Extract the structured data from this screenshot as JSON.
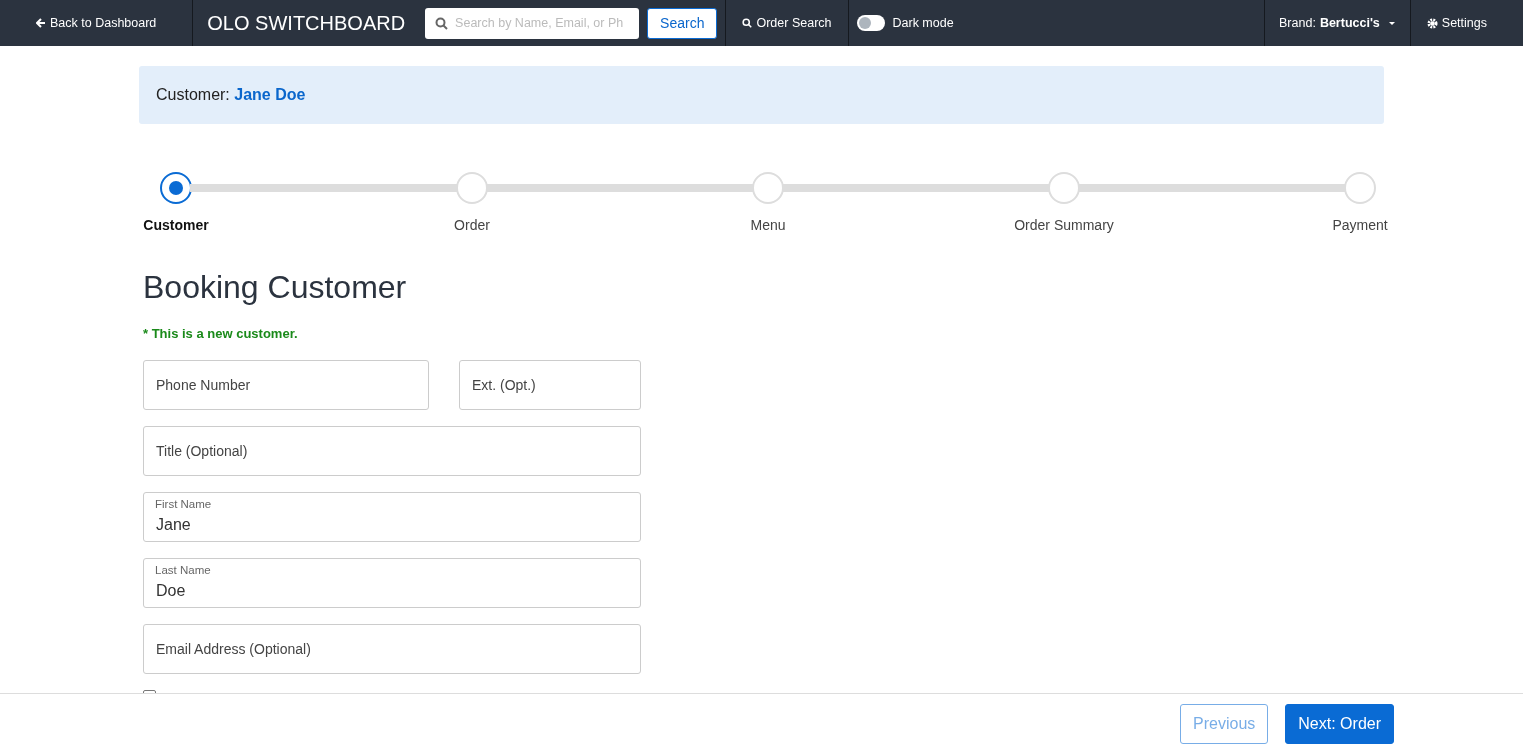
{
  "navbar": {
    "back_link": "Back to Dashboard",
    "brand": "OLO SWITCHBOARD",
    "search": {
      "placeholder": "Search by Name, Email, or Ph"
    },
    "search_button": "Search",
    "order_search": "Order Search",
    "dark_mode": {
      "label": "Dark mode",
      "on": false
    },
    "brand_menu": {
      "label": "Brand: ",
      "value": "Bertucci's"
    },
    "settings": "Settings"
  },
  "customer_banner": {
    "label": "Customer: ",
    "name": "Jane Doe"
  },
  "steps": [
    {
      "label": "Customer",
      "selected": true
    },
    {
      "label": "Order",
      "selected": false
    },
    {
      "label": "Menu",
      "selected": false
    },
    {
      "label": "Order Summary",
      "selected": false
    },
    {
      "label": "Payment",
      "selected": false
    }
  ],
  "heading": "Booking Customer",
  "notice": "* This is a new customer.",
  "field_rows": [
    [
      {
        "placeholder": "Phone Number"
      },
      {
        "placeholder": "Ext. (Opt.)"
      }
    ],
    [
      {
        "placeholder": "Title (Optional)"
      }
    ],
    [
      {
        "label": "First Name",
        "value": "Jane"
      }
    ],
    [
      {
        "label": "Last Name",
        "value": "Doe"
      }
    ],
    [
      {
        "placeholder": "Email Address (Optional)"
      }
    ]
  ],
  "checkbox": {
    "checked": false
  },
  "footer": {
    "previous": {
      "label": "Previous",
      "disabled": true
    },
    "next": {
      "label": "Next: Order",
      "disabled": false
    }
  }
}
